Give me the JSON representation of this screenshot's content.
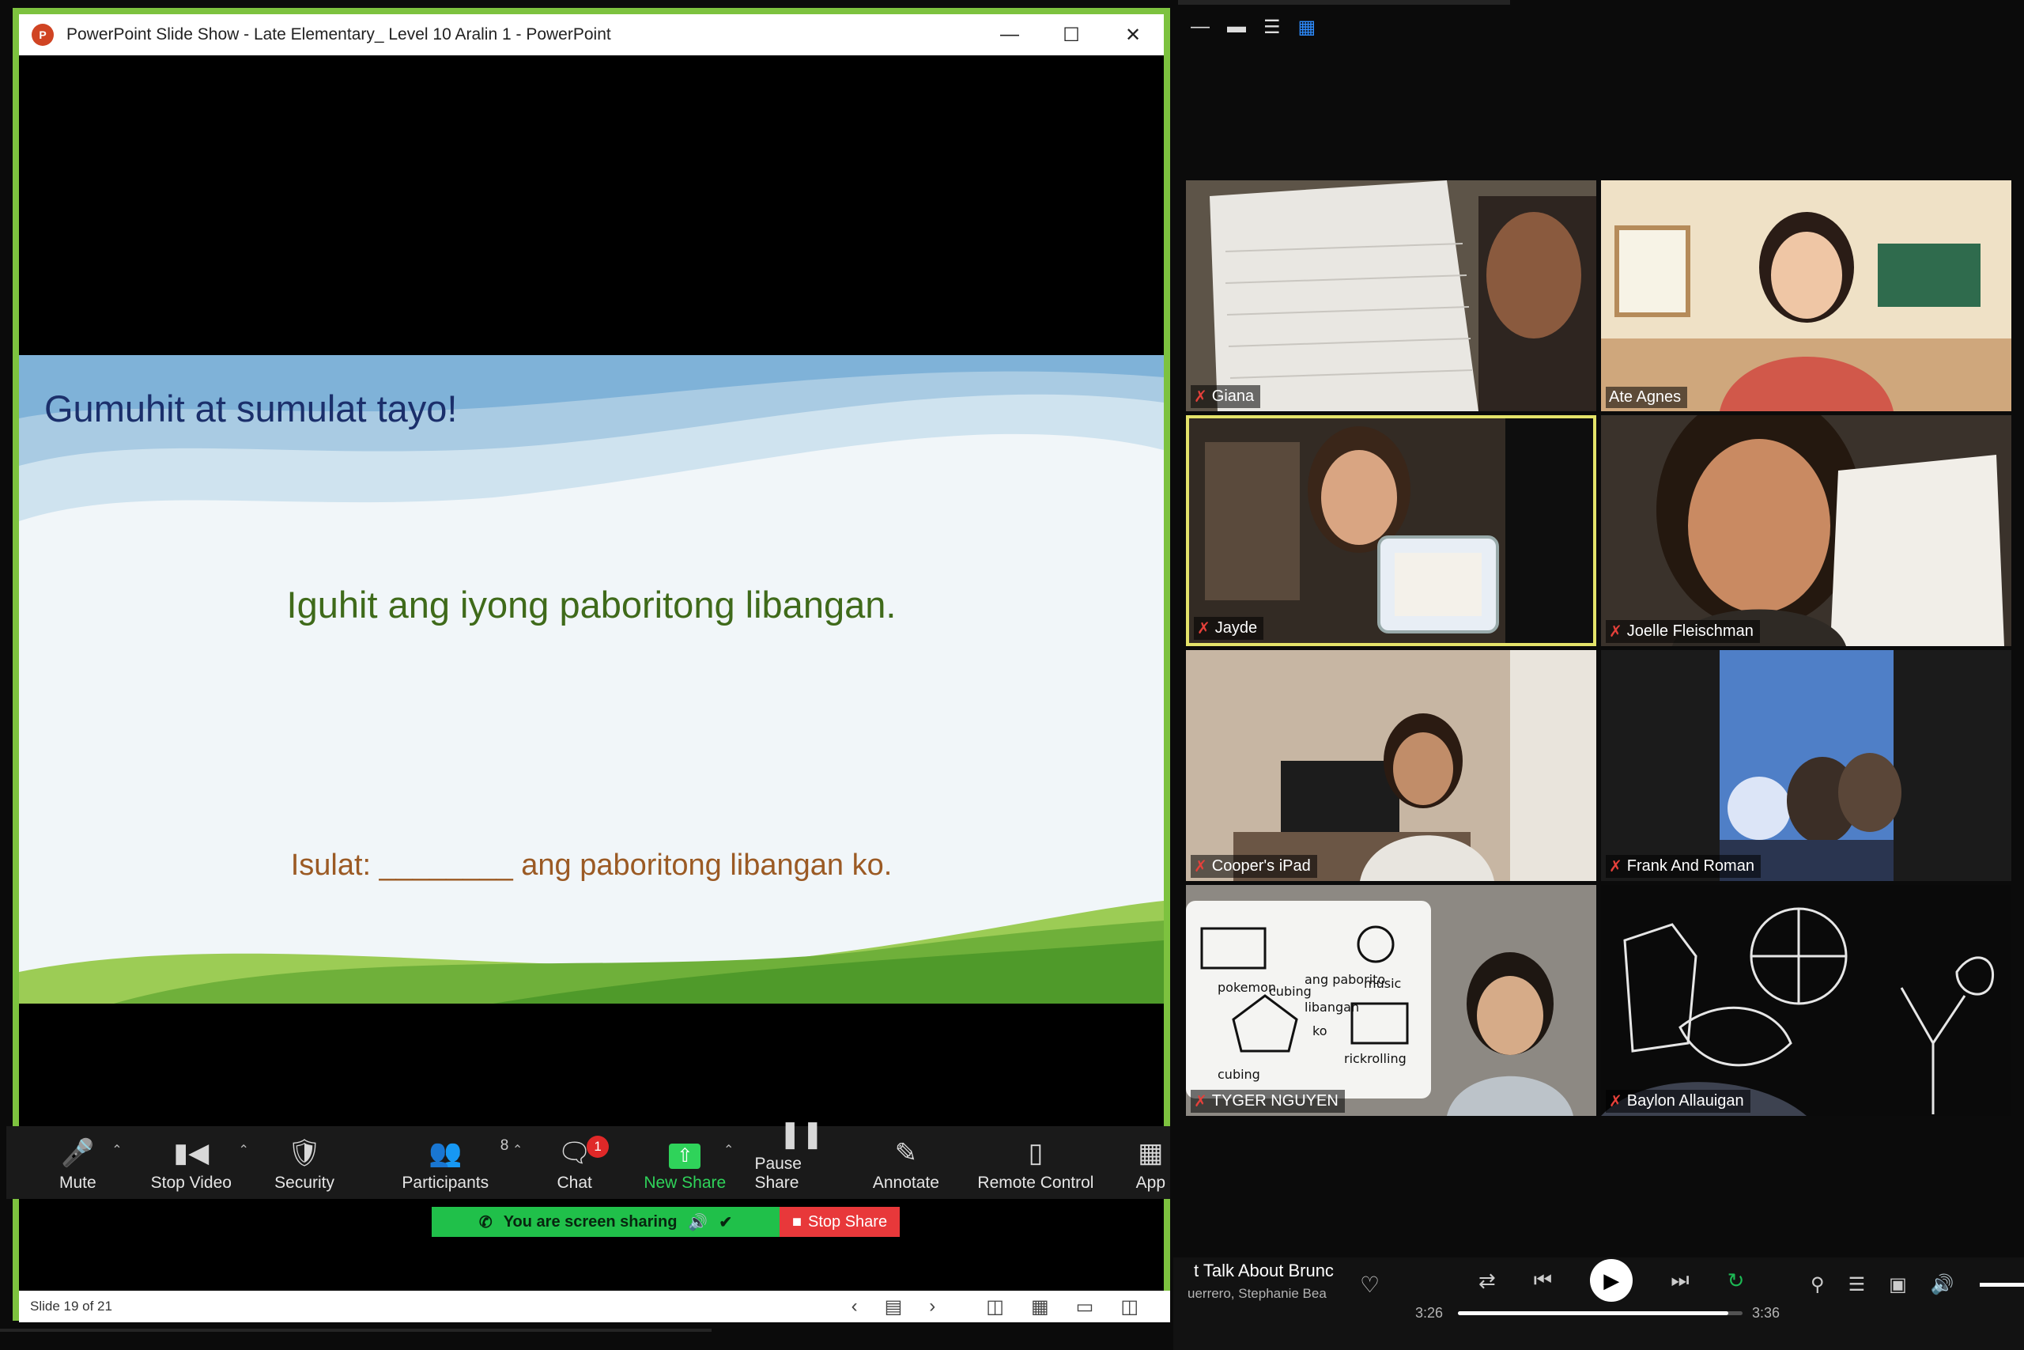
{
  "ppt": {
    "title": "PowerPoint Slide Show  -  Late Elementary_ Level 10 Aralin 1 - PowerPoint",
    "slide": {
      "title": "Gumuhit at sumulat tayo!",
      "prompt": "Iguhit ang iyong paboritong libangan.",
      "write": "Isulat: ________ ang paboritong libangan ko."
    },
    "status": "Slide 19 of 21"
  },
  "toolbar": {
    "mute": "Mute",
    "stop_video": "Stop Video",
    "security": "Security",
    "participants": "Participants",
    "participants_count": "8",
    "chat": "Chat",
    "chat_badge": "1",
    "new_share": "New Share",
    "pause_share": "Pause Share",
    "annotate": "Annotate",
    "remote_control": "Remote Control",
    "apps": "App"
  },
  "sharing": {
    "banner": "You are screen sharing",
    "stop": "Stop Share"
  },
  "participants": [
    {
      "name": "Giana"
    },
    {
      "name": "Ate Agnes"
    },
    {
      "name": "Jayde"
    },
    {
      "name": "Joelle Fleischman"
    },
    {
      "name": "Cooper's iPad"
    },
    {
      "name": "Frank And Roman"
    },
    {
      "name": "TYGER NGUYEN"
    },
    {
      "name": "Baylon Allauigan"
    }
  ],
  "drawing_labels": {
    "pokemon": "pokemon",
    "music": "music",
    "cubing": "cubing",
    "ang": "ang paborito",
    "libangan": "libangan",
    "ko": "ko",
    "cubing2": "cubing",
    "rick": "rickrolling"
  },
  "player": {
    "title": "t Talk About Brunc",
    "artist": "uerrero, Stephanie Bea",
    "elapsed": "3:26",
    "total": "3:36",
    "progress_fraction": 0.95
  }
}
